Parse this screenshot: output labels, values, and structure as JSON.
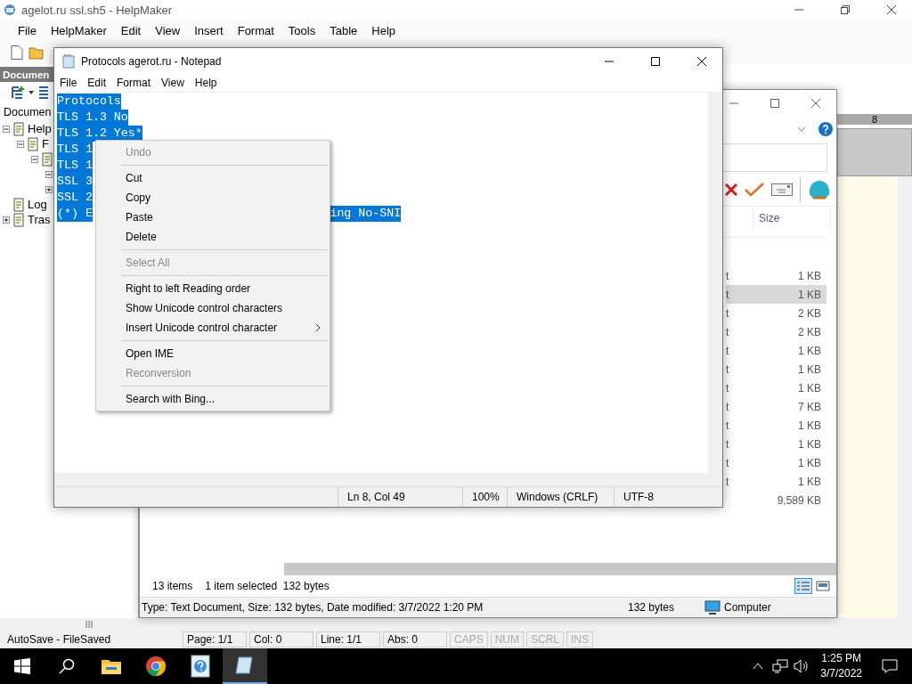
{
  "helpmaker": {
    "title": "agelot.ru ssl.sh5 - HelpMaker",
    "menu": [
      "File",
      "HelpMaker",
      "Edit",
      "View",
      "Insert",
      "Format",
      "Tools",
      "Table",
      "Help"
    ],
    "panel": {
      "header": "Documen",
      "label": "Documen",
      "tree": [
        {
          "label": "Help",
          "expanded": true,
          "children": [
            {
              "label": "F",
              "expanded": true,
              "children": [
                {
                  "expanded": true,
                  "children": [
                    {
                      "expanded": true
                    },
                    {
                      "expanded": false
                    }
                  ]
                }
              ]
            }
          ]
        },
        {
          "label": "Log"
        },
        {
          "label": "Tras",
          "expanded": false
        }
      ]
    },
    "ruler_label": "8",
    "status_bar": [
      {
        "text": "AutoSave - FileSaved",
        "disabled": false
      },
      {
        "text": "Page: 1/1",
        "disabled": false
      },
      {
        "text": "Col: 0",
        "disabled": false
      },
      {
        "text": "Line: 1/1",
        "disabled": false
      },
      {
        "text": "Abs: 0",
        "disabled": false
      },
      {
        "text": "CAPS",
        "disabled": true
      },
      {
        "text": "NUM",
        "disabled": true
      },
      {
        "text": "SCRL",
        "disabled": true
      },
      {
        "text": "INS",
        "disabled": true
      }
    ]
  },
  "explorer": {
    "column_header": "Size",
    "rows": [
      {
        "column_1": "t",
        "size": "1 KB",
        "selected": false
      },
      {
        "column_1": "t",
        "size": "1 KB",
        "selected": true
      },
      {
        "column_1": "t",
        "size": "2 KB",
        "selected": false
      },
      {
        "column_1": "t",
        "size": "2 KB",
        "selected": false
      },
      {
        "column_1": "t",
        "size": "1 KB",
        "selected": false
      },
      {
        "column_1": "t",
        "size": "1 KB",
        "selected": false
      },
      {
        "column_1": "t",
        "size": "1 KB",
        "selected": false
      },
      {
        "column_1": "t",
        "size": "7 KB",
        "selected": false
      },
      {
        "column_1": "t",
        "size": "1 KB",
        "selected": false
      },
      {
        "column_1": "t",
        "size": "1 KB",
        "selected": false
      },
      {
        "column_1": "t",
        "size": "1 KB",
        "selected": false
      },
      {
        "column_1": "t",
        "size": "1 KB",
        "selected": false
      },
      {
        "size": "9,589 KB",
        "selected": false
      }
    ],
    "item_count": "13 items",
    "selection_info": "1 item selected  132 bytes",
    "details": "Type: Text Document, Size: 132 bytes, Date modified: 3/7/2022 1:20 PM",
    "details_size": "132 bytes",
    "location": "Computer"
  },
  "notepad": {
    "title": "Protocols agerot.ru - Notepad",
    "menu": [
      "File",
      "Edit",
      "Format",
      "View",
      "Help"
    ],
    "selected": true,
    "lines": [
      {
        "text": "Protocols"
      },
      {
        "text": "TLS 1.3 No"
      },
      {
        "text": "TLS 1.2 Yes*"
      },
      {
        "text": "TLS 1"
      },
      {
        "text": "TLS 1"
      },
      {
        "text": "SSL 3"
      },
      {
        "text": "SSL 2"
      },
      {
        "text": "(*) E",
        "tail": "ing No-SNI"
      }
    ],
    "status": [
      "Ln 8, Col 49",
      "100%",
      "Windows (CRLF)",
      "UTF-8"
    ]
  },
  "context_menu": [
    {
      "kind": "item",
      "label": "Undo",
      "disabled": true
    },
    {
      "kind": "separator"
    },
    {
      "kind": "item",
      "label": "Cut",
      "disabled": false
    },
    {
      "kind": "item",
      "label": "Copy",
      "disabled": false
    },
    {
      "kind": "item",
      "label": "Paste",
      "disabled": false
    },
    {
      "kind": "item",
      "label": "Delete",
      "disabled": false
    },
    {
      "kind": "separator"
    },
    {
      "kind": "item",
      "label": "Select All",
      "disabled": true
    },
    {
      "kind": "separator"
    },
    {
      "kind": "item",
      "label": "Right to left Reading order",
      "disabled": false
    },
    {
      "kind": "item",
      "label": "Show Unicode control characters",
      "disabled": false
    },
    {
      "kind": "submenu",
      "label": "Insert Unicode control character",
      "disabled": false
    },
    {
      "kind": "separator"
    },
    {
      "kind": "item",
      "label": "Open IME",
      "disabled": false
    },
    {
      "kind": "item",
      "label": "Reconversion",
      "disabled": true
    },
    {
      "kind": "separator"
    },
    {
      "kind": "item",
      "label": "Search with Bing...",
      "disabled": false
    }
  ],
  "taskbar": {
    "apps": [
      {
        "kind": "file-explorer",
        "active": false
      },
      {
        "kind": "chrome",
        "active": false
      },
      {
        "kind": "helpmaker",
        "active": false
      },
      {
        "kind": "notepad",
        "active": true
      }
    ],
    "time": "1:25 PM",
    "date": "3/7/2022"
  }
}
